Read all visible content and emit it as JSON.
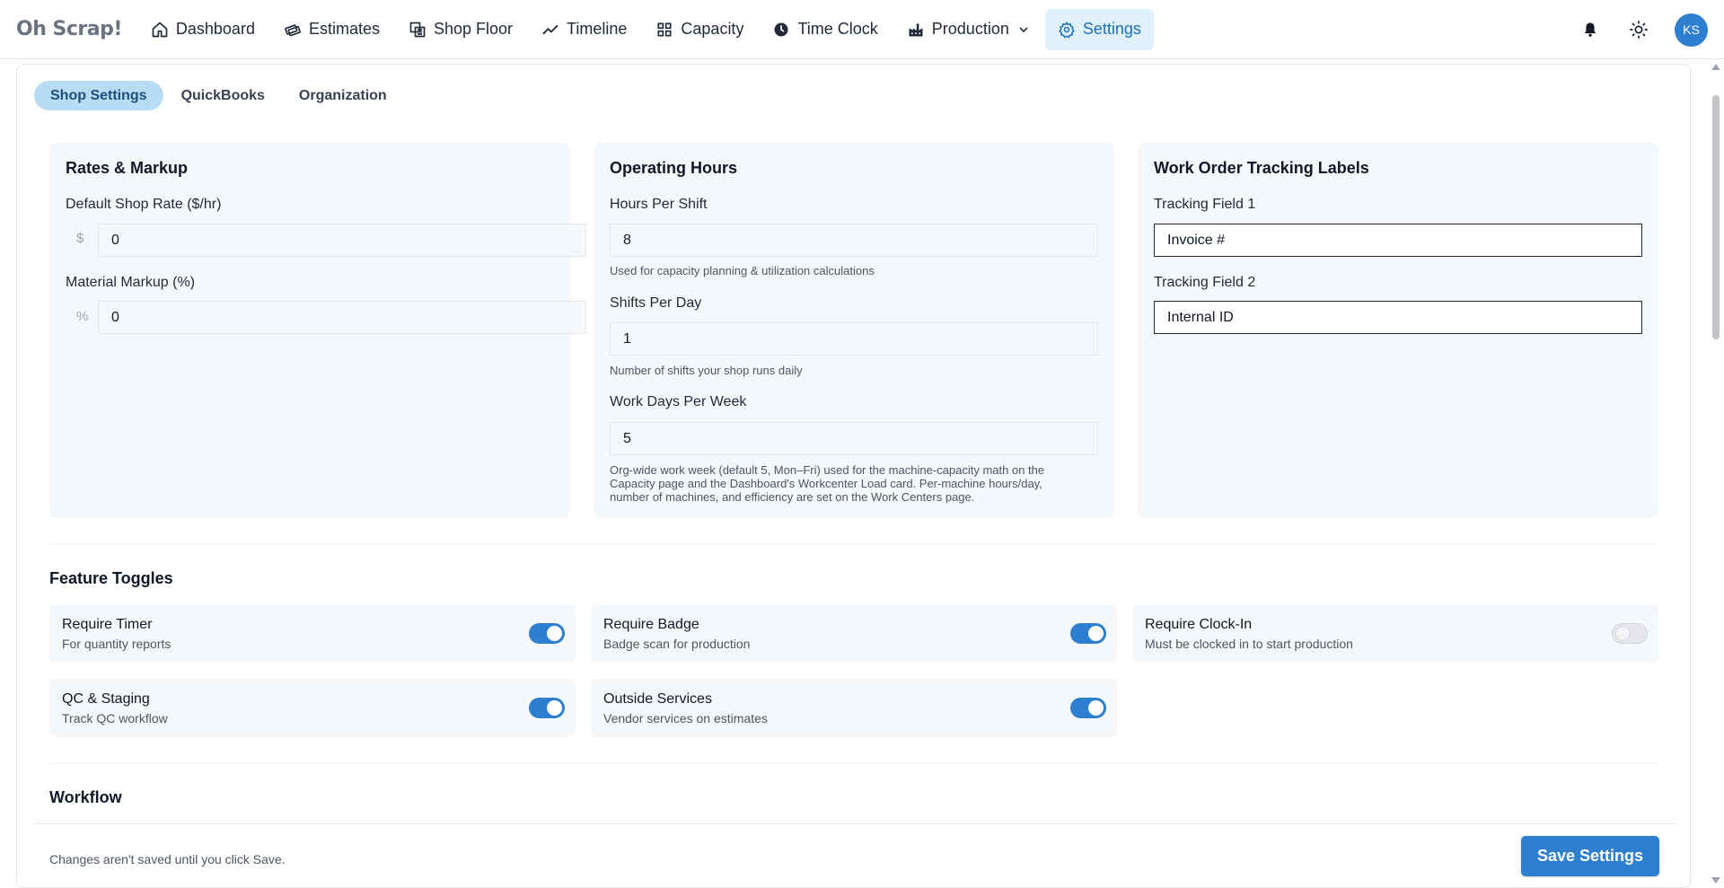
{
  "brand": "Oh Scrap!",
  "nav": {
    "items": [
      {
        "label": "Dashboard",
        "icon": "home-icon"
      },
      {
        "label": "Estimates",
        "icon": "money-icon"
      },
      {
        "label": "Shop Floor",
        "icon": "layers-icon"
      },
      {
        "label": "Timeline",
        "icon": "trend-icon"
      },
      {
        "label": "Capacity",
        "icon": "grid-icon"
      },
      {
        "label": "Time Clock",
        "icon": "clock-icon"
      },
      {
        "label": "Production",
        "icon": "factory-icon"
      },
      {
        "label": "Settings",
        "icon": "gear-icon"
      }
    ],
    "active": "Settings",
    "avatar_initials": "KS"
  },
  "tabs": [
    {
      "label": "Shop Settings",
      "active": true
    },
    {
      "label": "QuickBooks",
      "active": false
    },
    {
      "label": "Organization",
      "active": false
    }
  ],
  "rates": {
    "title": "Rates & Markup",
    "shop_rate_label": "Default Shop Rate ($/hr)",
    "shop_rate_prefix": "$",
    "shop_rate_value": "0",
    "markup_label": "Material Markup (%)",
    "markup_prefix": "%",
    "markup_value": "0"
  },
  "hours": {
    "title": "Operating Hours",
    "per_shift_label": "Hours Per Shift",
    "per_shift_value": "8",
    "per_shift_hint": "Used for capacity planning & utilization calculations",
    "shifts_label": "Shifts Per Day",
    "shifts_value": "1",
    "shifts_hint": "Number of shifts your shop runs daily",
    "workdays_label": "Work Days Per Week",
    "workdays_value": "5",
    "workdays_hint_1": "Org-wide work week (default 5, Mon–Fri) used for the machine-capacity math on the",
    "workdays_hint_2": "Capacity page and the Dashboard's Workcenter Load card. Per-machine hours/day,",
    "workdays_hint_3": "number of machines, and efficiency are set on the Work Centers page."
  },
  "tracking": {
    "title": "Work Order Tracking Labels",
    "field1_label": "Tracking Field 1",
    "field1_value": "Invoice #",
    "field2_label": "Tracking Field 2",
    "field2_value": "Internal ID"
  },
  "toggles": {
    "title": "Feature Toggles",
    "items": [
      {
        "title": "Require Timer",
        "sub": "For quantity reports",
        "on": true
      },
      {
        "title": "Require Badge",
        "sub": "Badge scan for production",
        "on": true
      },
      {
        "title": "Require Clock-In",
        "sub": "Must be clocked in to start production",
        "on": false
      },
      {
        "title": "QC & Staging",
        "sub": "Track QC workflow",
        "on": true
      },
      {
        "title": "Outside Services",
        "sub": "Vendor services on estimates",
        "on": true
      }
    ]
  },
  "workflow": {
    "title": "Workflow"
  },
  "footer": {
    "note": "Changes aren't saved until you click Save.",
    "save_label": "Save Settings"
  },
  "colors": {
    "accent": "#2f7fd1",
    "active_nav_bg": "#e0f0fb",
    "active_tab_bg": "#b9dcf5",
    "panel_bg": "#f5f8fb"
  }
}
